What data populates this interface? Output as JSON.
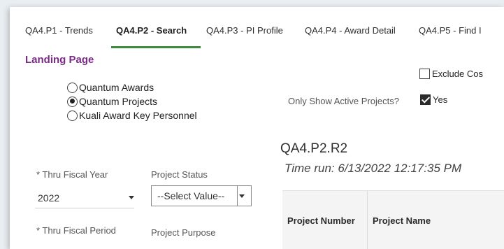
{
  "tabs": [
    {
      "label": "QA4.P1 - Trends",
      "active": false
    },
    {
      "label": "QA4.P2 - Search",
      "active": true
    },
    {
      "label": "QA4.P3 - PI Profile",
      "active": false
    },
    {
      "label": "QA4.P4 - Award Detail",
      "active": false
    },
    {
      "label": "QA4.P5 - Find I",
      "active": false
    }
  ],
  "landing": {
    "heading": "Landing Page",
    "options": [
      {
        "label": "Quantum Awards",
        "selected": false
      },
      {
        "label": "Quantum Projects",
        "selected": true
      },
      {
        "label": "Kuali Award Key Personnel",
        "selected": false
      }
    ]
  },
  "filters": {
    "exclude_label": "Exclude Cos",
    "exclude_checked": false,
    "active_projects_question": "Only Show Active Projects?",
    "active_projects_answer": "Yes",
    "active_projects_checked": true,
    "thru_fiscal_year_label": "* Thru Fiscal Year",
    "thru_fiscal_year_value": "2022",
    "project_status_label": "Project Status",
    "project_status_value": "--Select Value--",
    "thru_fiscal_period_label": "* Thru Fiscal Period",
    "project_purpose_label": "Project Purpose"
  },
  "report": {
    "id": "QA4.P2.R2",
    "time_run": "Time run: 6/13/2022 12:17:35 PM",
    "columns": [
      "Project Number",
      "Project Name"
    ]
  },
  "colors": {
    "accent_green": "#3f8a3c",
    "landing_purple": "#7a2b86"
  }
}
